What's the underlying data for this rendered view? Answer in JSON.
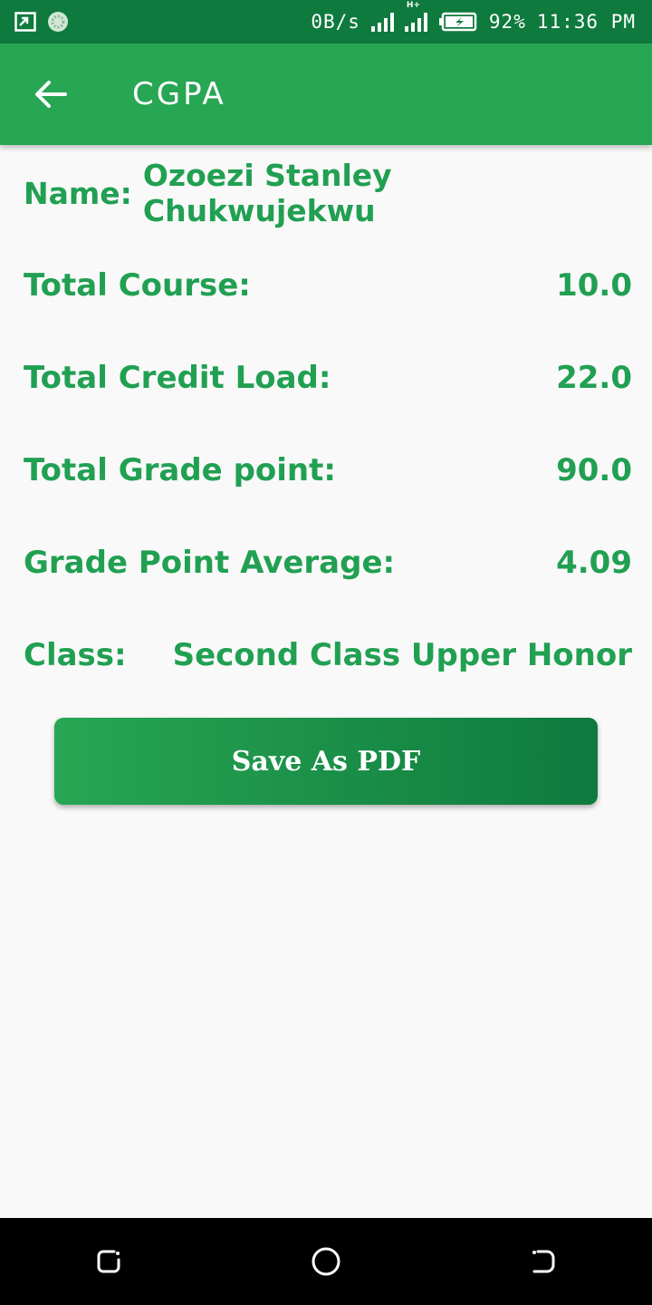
{
  "status_bar": {
    "speed": "0B/s",
    "network": "H+",
    "battery": "92%",
    "time": "11:36 PM"
  },
  "app_bar": {
    "title": "CGPA",
    "back_icon": "arrow-back-icon"
  },
  "result": {
    "name_label": "Name:",
    "name_value": "Ozoezi Stanley Chukwujekwu",
    "total_course_label": "Total Course:",
    "total_course_value": "10.0",
    "total_credit_label": "Total Credit Load:",
    "total_credit_value": "22.0",
    "total_grade_label": "Total Grade point:",
    "total_grade_value": "90.0",
    "gpa_label": "Grade Point Average:",
    "gpa_value": "4.09",
    "class_label": "Class:",
    "class_value": "Second Class Upper Honor"
  },
  "actions": {
    "save_label": "Save As PDF"
  },
  "colors": {
    "primary": "#27a653",
    "primary_dark": "#0f7a3e",
    "text": "#21a052",
    "background": "#f9f9f9"
  },
  "nav_icons": [
    "recent-apps-icon",
    "home-icon",
    "back-icon"
  ]
}
